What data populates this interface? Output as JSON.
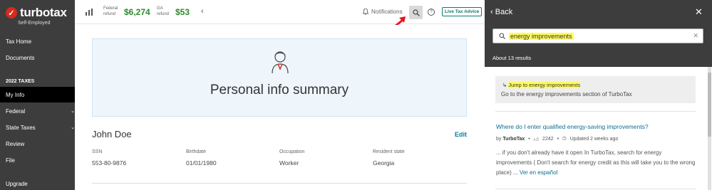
{
  "brand": {
    "name": "turbotax",
    "subtitle": "Self-Employed"
  },
  "sidebar": {
    "items": [
      {
        "label": "Tax Home"
      },
      {
        "label": "Documents"
      }
    ],
    "section": "2022 TAXES",
    "nav": [
      {
        "label": "My Info",
        "active": true
      },
      {
        "label": "Federal",
        "chevron": true
      },
      {
        "label": "State Taxes",
        "chevron": true
      },
      {
        "label": "Review"
      },
      {
        "label": "File"
      }
    ],
    "upgrade": "Upgrade"
  },
  "topbar": {
    "federal_label_1": "Federal",
    "federal_label_2": "refund",
    "federal_value": "$6,274",
    "state_label_1": "GA",
    "state_label_2": "refund",
    "state_value": "$53",
    "notifications": "Notifications",
    "live_advice": "Live Tax Advice"
  },
  "main": {
    "summary_title": "Personal info summary",
    "name": "John Doe",
    "edit": "Edit",
    "fields": [
      {
        "label": "SSN",
        "value": "553-80-9876"
      },
      {
        "label": "Birthdate",
        "value": "01/01/1980"
      },
      {
        "label": "Occupation",
        "value": "Worker"
      },
      {
        "label": "Resident state",
        "value": "Georgia"
      }
    ]
  },
  "search_panel": {
    "back": "Back",
    "query": "energy improvements",
    "results_count": "About 13 results",
    "jump_title": "Jump to energy improvements",
    "jump_desc": "Go to the energy improvements section of TurboTax",
    "result": {
      "title": "Where do I enter qualified energy-saving improvements?",
      "by": "by",
      "author": "TurboTax",
      "likes": "2242",
      "updated": "Updated 2 weeks ago",
      "snippet": "... if you don't already have it open In TurboTax, search for energy improvements ( Don't search for energy credit as this will take you to the wrong place) ...",
      "link": "Ver en español"
    }
  },
  "colors": {
    "accent_green": "#2d8a2d",
    "highlight": "#fffb5c",
    "link": "#0a6e8f",
    "arrow": "#e0161f"
  }
}
